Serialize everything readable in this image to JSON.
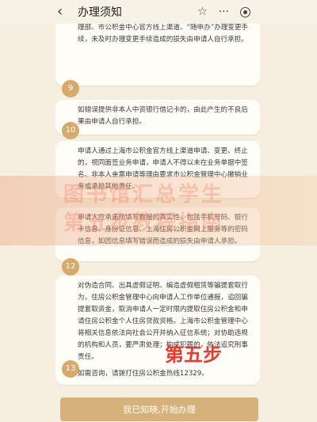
{
  "header": {
    "title": "办理须知",
    "more_label": "···",
    "bookmark_icon": "bookmark-icon",
    "back_icon": "chevron-left-icon",
    "target_icon": "target-icon"
  },
  "cards": [
    {
      "number": "",
      "text": "理部、市公积金中心官方线上渠道、“随申办”办理变更手续，未及时办理变更手续造成的损失由申请人自行承担。"
    },
    {
      "number": "9",
      "text": "如错误提供非本人中资银行借记卡的，由此产生的不良后果由申请人自行承担。"
    },
    {
      "number": "10",
      "text": "申请人通过上海市公积金官方线上渠道申请、变更、终止的，视同面签业务申请，申请人不得以未在业务单据中签名、非本人亲票申请等理由要求市公积金管理中心撤销业务或承担其他责任。"
    },
    {
      "number": "",
      "text": "申请人应承诺所填写数据的真实性，包括手机号码、银行卡信息、身份证信息、上海住房公积金网上服务等的密码信息，如因信息填写错误而造成的损失由申请人承担。"
    },
    {
      "number": "12",
      "text": "对伪造合同、出具虚假证明、编造虚假租赁等骗提套取行为，住房公积金管理中心向申请人工作单位通报，追回骗提套取资金，取消申请人一定时限内提取住房公积金和申请住房公积金个人住房贷款资格。上海市公积金管理中心将相关信息依法向社会公开并纳入征信系统；对协助违规的机构和人员，要严肃处理；构成犯罪的，依法追究刑事责任。"
    },
    {
      "number": "13",
      "text": "如需咨询，请拨打住房公积金热线12329。"
    }
  ],
  "watermark": {
    "line1": "图书馆汇总学生",
    "line2": "第五步教程指南"
  },
  "step_label": "第五步",
  "bottom_button": {
    "label": "我已知晓,开始办理"
  },
  "colors": {
    "accent": "#d6b27a",
    "badge": "#d5aa6c",
    "background": "#f6efdf",
    "step_label": "#e63a2e"
  }
}
